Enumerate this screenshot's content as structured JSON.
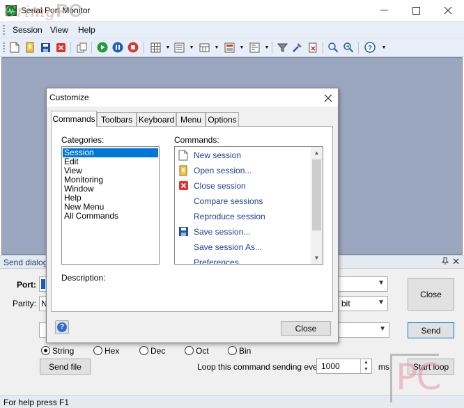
{
  "window": {
    "title": "Serial Port Monitor",
    "watermark_script": "Crimg",
    "watermark_pc": "PC"
  },
  "menu": {
    "items": [
      "Session",
      "View",
      "Help"
    ]
  },
  "toolbar": {
    "icons": [
      "new-session-icon",
      "open-session-icon",
      "save-session-icon",
      "close-session-icon",
      "copy-icon",
      "start-icon",
      "pause-icon",
      "stop-icon",
      "grid-icon",
      "list-icon",
      "table-icon",
      "layout-icon",
      "panel-icon",
      "filter-icon",
      "tools-icon",
      "clear-icon",
      "search-icon",
      "find-next-icon",
      "help-icon"
    ]
  },
  "send_panel": {
    "title": "Send dialog",
    "port_label": "Port:",
    "parity_label": "Parity:",
    "parity_value": "N",
    "stopbit_value": "p bit",
    "close_label": "Close",
    "send_label": "Send",
    "formats": [
      "String",
      "Hex",
      "Dec",
      "Oct",
      "Bin"
    ],
    "selected_format": "String",
    "send_file_label": "Send file",
    "loop_label": "Loop this command sending every",
    "loop_value": "1000",
    "loop_unit": "ms",
    "start_loop_label": "Start loop"
  },
  "status": {
    "text": "For help press F1"
  },
  "customize": {
    "title": "Customize",
    "tabs": [
      "Commands",
      "Toolbars",
      "Keyboard",
      "Menu",
      "Options"
    ],
    "active_tab": "Commands",
    "categories_label": "Categories:",
    "categories": [
      "Session",
      "Edit",
      "View",
      "Monitoring",
      "Window",
      "Help",
      "New Menu",
      "All Commands"
    ],
    "selected_category": "Session",
    "commands_label": "Commands:",
    "commands": [
      {
        "label": "New session",
        "icon": "new-document-icon"
      },
      {
        "label": "Open session...",
        "icon": "open-folder-icon"
      },
      {
        "label": "Close session",
        "icon": "close-red-icon"
      },
      {
        "label": "Compare sessions",
        "icon": ""
      },
      {
        "label": "Reproduce session",
        "icon": ""
      },
      {
        "label": "Save session...",
        "icon": "floppy-disk-icon"
      },
      {
        "label": "Save session As...",
        "icon": ""
      },
      {
        "label": "Preferences",
        "icon": ""
      }
    ],
    "description_label": "Description:",
    "close_label": "Close",
    "help_glyph": "?"
  }
}
